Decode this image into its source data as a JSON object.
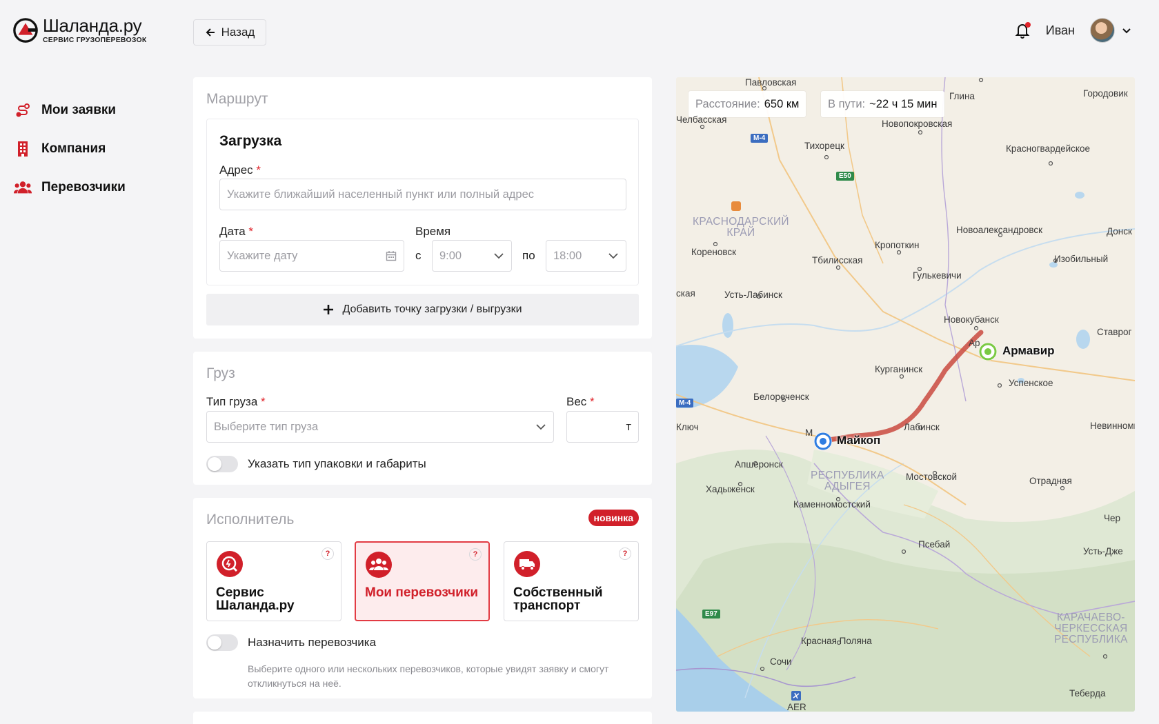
{
  "header": {
    "logo_title": "Шаланда.ру",
    "logo_subtitle": "СЕРВИС ГРУЗОПЕРЕВОЗОК",
    "back_label": "Назад",
    "user_name": "Иван"
  },
  "sidebar": {
    "items": [
      {
        "label": "Мои заявки",
        "icon": "route-icon"
      },
      {
        "label": "Компания",
        "icon": "building-icon"
      },
      {
        "label": "Перевозчики",
        "icon": "users-icon"
      }
    ]
  },
  "route": {
    "title": "Маршрут",
    "loading_title": "Загрузка",
    "address_label": "Адрес",
    "address_placeholder": "Укажите ближайший населенный пункт или полный адрес",
    "date_label": "Дата",
    "date_placeholder": "Укажите дату",
    "time_label": "Время",
    "from_label": "с",
    "from_value": "9:00",
    "to_label": "по",
    "to_value": "18:00",
    "add_point_label": "Добавить точку загрузки / выгрузки",
    "required_mark": "*"
  },
  "cargo": {
    "title": "Груз",
    "type_label": "Тип груза",
    "type_placeholder": "Выберите тип груза",
    "weight_label": "Вес",
    "weight_unit": "т",
    "packaging_toggle_label": "Указать тип упаковки и габариты"
  },
  "executor": {
    "title": "Исполнитель",
    "badge_new": "новинка",
    "help_mark": "?",
    "options": [
      {
        "label": "Сервис Шаланда.ру",
        "icon": "search-service-icon",
        "selected": false
      },
      {
        "label": "Мои перевозчики",
        "icon": "group-icon",
        "selected": true
      },
      {
        "label": "Собственный транспорт",
        "icon": "truck-icon",
        "selected": false
      }
    ],
    "assign_toggle_label": "Назначить перевозчика",
    "assign_hint": "Выберите одного или нескольких перевозчиков, которые увидят заявку и смогут откликнуться на неё."
  },
  "map": {
    "distance_label": "Расстояние:",
    "distance_value": "650 км",
    "duration_label": "В пути:",
    "duration_value": "~22 ч 15 мин",
    "start_city": "Майкоп",
    "end_city": "Армавир",
    "regions": [
      "КРАСНОДАРСКИЙ\nКРАЙ",
      "РЕСПУБЛИКА\nАДЫГЕЯ",
      "КАРАЧАЕВО-\nЧЕРКЕССКАЯ\nРЕСПУБЛИКА"
    ],
    "cities": [
      "Павловская",
      "Глина",
      "Городовик",
      "Челбасская",
      "Новопокровская",
      "Тихорецк",
      "Красногвардейское",
      "Новоалександровск",
      "Донск",
      "Кропоткин",
      "Кореновск",
      "Тбилисская",
      "Изобильный",
      "Гулькевичи",
      "ская",
      "Усть-Лабинск",
      "Новокубанск",
      "Ставрог",
      "Ар",
      "Курганинск",
      "Успенское",
      "Белореченск",
      "Ключ",
      "М",
      "Лабинск",
      "Невинномы",
      "Апшеронск",
      "Мостовской",
      "Отрадная",
      "Хадыженск",
      "Каменномостский",
      "Чер",
      "Псебай",
      "Усть-Дже",
      "Красная Поляна",
      "Сочи",
      "Теберда",
      "AER"
    ],
    "roads": [
      "М-4",
      "E50",
      "М-4",
      "E97"
    ],
    "colors": {
      "start": "#2f7de1",
      "end": "#7ac943",
      "route": "#c94a40"
    }
  }
}
